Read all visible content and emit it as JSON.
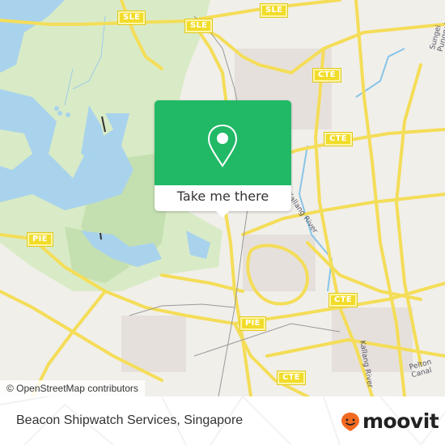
{
  "map": {
    "popup": {
      "button_label": "Take me there",
      "accent_color": "#21b966"
    },
    "road_labels": [
      {
        "name": "SLE"
      },
      {
        "name": "SLE"
      },
      {
        "name": "SLE"
      },
      {
        "name": "CTE"
      },
      {
        "name": "CTE"
      },
      {
        "name": "CTE"
      },
      {
        "name": "CTE"
      },
      {
        "name": "PIE"
      },
      {
        "name": "PIE"
      }
    ],
    "area_labels": {
      "river": "Kallang River",
      "sungei": "Sungei Punggol",
      "kallang": "Kallang River",
      "pelton": "Pelton Canal"
    },
    "attribution": "© OpenStreetMap contributors"
  },
  "footer": {
    "place_name": "Beacon Shipwatch Services, Singapore",
    "logo_text": "moovit",
    "logo_color": "#f26a21"
  }
}
